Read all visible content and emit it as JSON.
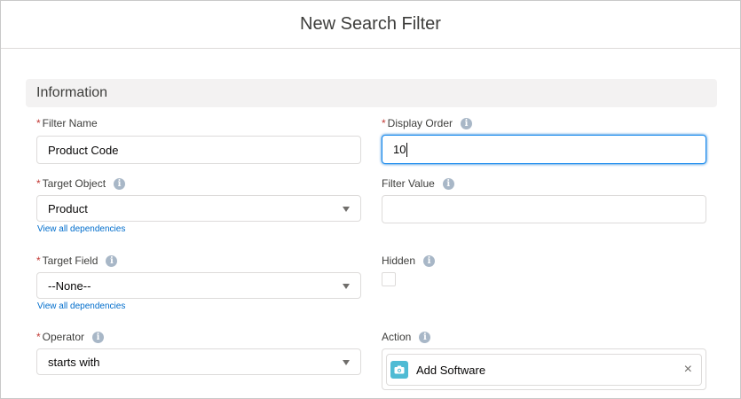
{
  "modal": {
    "title": "New Search Filter"
  },
  "section": {
    "title": "Information"
  },
  "fields": {
    "filter_name": {
      "label": "Filter Name",
      "value": "Product Code"
    },
    "display_order": {
      "label": "Display Order",
      "value": "10"
    },
    "target_object": {
      "label": "Target Object",
      "value": "Product",
      "link": "View all dependencies"
    },
    "filter_value": {
      "label": "Filter Value",
      "value": ""
    },
    "target_field": {
      "label": "Target Field",
      "value": "--None--",
      "link": "View all dependencies"
    },
    "hidden": {
      "label": "Hidden",
      "checked": false
    },
    "operator": {
      "label": "Operator",
      "value": "starts with"
    },
    "action": {
      "label": "Action",
      "value": "Add Software"
    }
  },
  "icons": {
    "info": "i",
    "close": "×"
  }
}
